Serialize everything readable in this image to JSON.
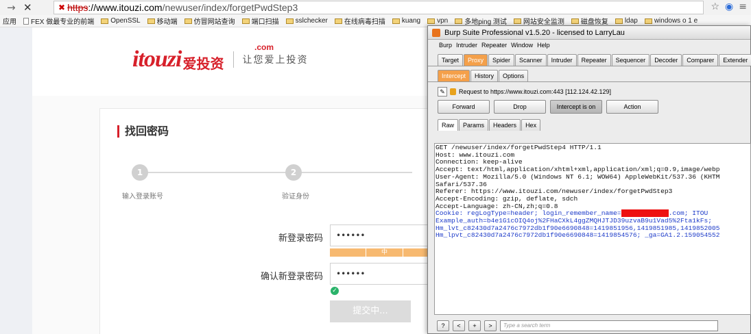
{
  "browser": {
    "url_scheme": "https",
    "url_domain": "://www.itouzi.com",
    "url_path": "/newuser/index/forgetPwdStep3",
    "bookmarks": [
      "应用",
      "FEX 做最专业的前端",
      "OpenSSL",
      "移动端",
      "仿冒网站查询",
      "端口扫描",
      "sslchecker",
      "在线病毒扫描",
      "kuang",
      "vpn",
      "多地ping 测试",
      "网站安全监测",
      "磁盘恢复",
      "ldap",
      "windows o 1 e"
    ]
  },
  "site": {
    "brand": "itouzi",
    "brand_cn": "爱投资",
    "brand_com": ".com",
    "slogan": "让您爱上投资",
    "title": "找回密码",
    "steps": [
      {
        "num": "1",
        "label": "输入登录账号"
      },
      {
        "num": "2",
        "label": "验证身份"
      }
    ],
    "new_pwd_label": "新登录密码",
    "new_pwd_value": "••••••",
    "strength_mid": "中",
    "confirm_pwd_label": "确认新登录密码",
    "confirm_pwd_value": "••••••",
    "submit_label": "提交中..."
  },
  "burp": {
    "title": "Burp Suite Professional v1.5.20 - licensed to LarryLau",
    "menu": [
      "Burp",
      "Intruder",
      "Repeater",
      "Window",
      "Help"
    ],
    "main_tabs": [
      "Target",
      "Proxy",
      "Spider",
      "Scanner",
      "Intruder",
      "Repeater",
      "Sequencer",
      "Decoder",
      "Comparer",
      "Extender"
    ],
    "sub_tabs": [
      "Intercept",
      "History",
      "Options"
    ],
    "request_to": "Request to https://www.itouzi.com:443  [112.124.42.129]",
    "buttons": {
      "forward": "Forward",
      "drop": "Drop",
      "intercept": "Intercept is on",
      "action": "Action"
    },
    "raw_tabs": [
      "Raw",
      "Params",
      "Headers",
      "Hex"
    ],
    "request_lines": [
      "GET /newuser/index/forgetPwdStep4 HTTP/1.1",
      "Host: www.itouzi.com",
      "Connection: keep-alive",
      "Accept: text/html,application/xhtml+xml,application/xml;q=0.9,image/webp",
      "User-Agent: Mozilla/5.0 (Windows NT 6.1; WOW64) AppleWebKit/537.36 (KHTM",
      "Safari/537.36",
      "Referer: https://www.itouzi.com/newuser/index/forgetPwdStep3",
      "Accept-Encoding: gzip, deflate, sdch",
      "Accept-Language: zh-CN,zh;q=0.8"
    ],
    "cookie_start": "Cookie: regLogType=header; login_remember_name=",
    "cookie_end": ".com; ITOU",
    "cookie_line2": "Example_auth=b4e1G1cOIQ4oj%2FHaCXkL4ggZMQHJTJD39uzvaB9u1Vad5%2Fta1kFs;",
    "cookie_line3": "Hm_lvt_c82430d7a2476c7972db1f90e6690848=1419851956,1419851985,1419852005",
    "cookie_line4": "Hm_lpvt_c82430d7a2476c7972db1f90e6690848=1419854576; _ga=GA1.2.159054552",
    "bottom_buttons": [
      "?",
      "<",
      "+",
      ">"
    ],
    "search_placeholder": "Type a search term"
  }
}
